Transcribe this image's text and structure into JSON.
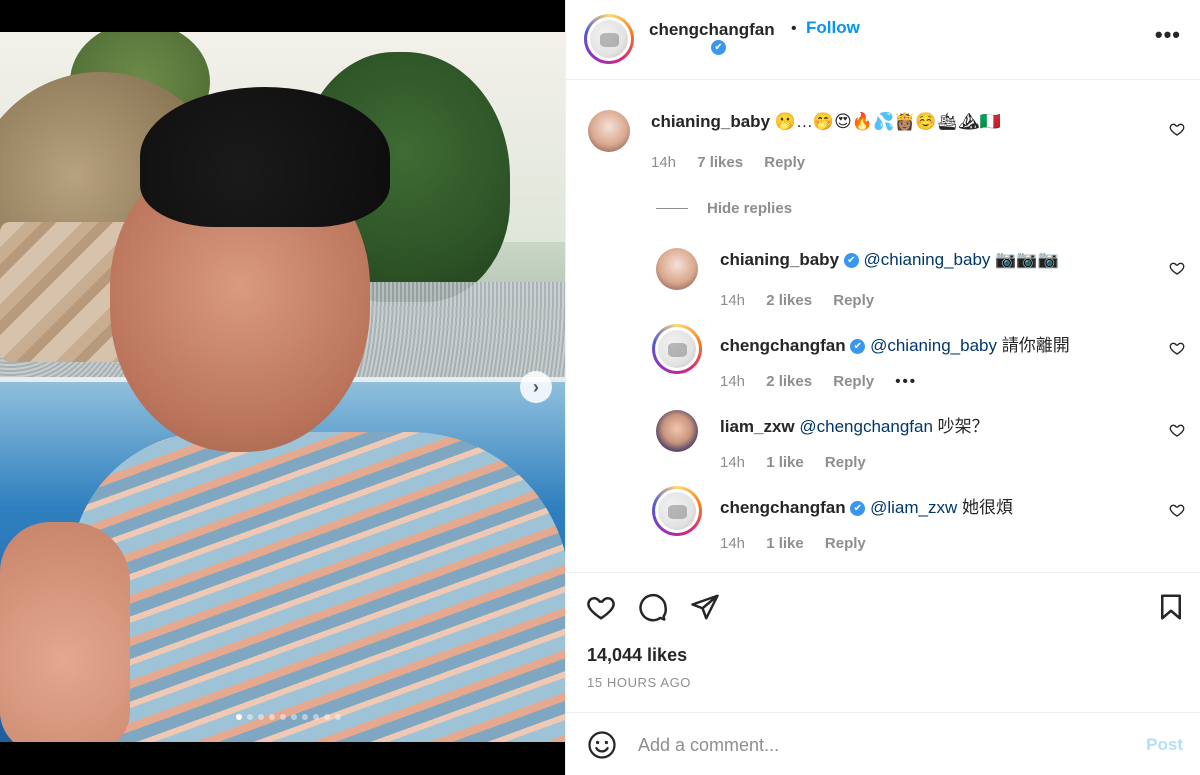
{
  "post": {
    "author": "chengchangfan",
    "follow_label": "Follow",
    "separator": "•",
    "verified_glyph": "✔",
    "more_glyph": "•••",
    "carousel": {
      "slide_count": 10,
      "active_index": 0,
      "next_glyph": "›"
    }
  },
  "comments": [
    {
      "user": "chianing_baby",
      "text": "🫢…🤭😍🔥💦👸🏽☺️🛳⛰🇮🇹",
      "time": "14h",
      "likes": "7 likes",
      "reply_label": "Reply"
    }
  ],
  "hide_replies_label": "Hide replies",
  "replies": [
    {
      "user": "chianing_baby",
      "mention": "@chianing_baby",
      "text": "📷📷📷",
      "time": "14h",
      "likes": "2 likes",
      "reply_label": "Reply"
    },
    {
      "user": "chengchangfan",
      "mention": "@chianing_baby",
      "text": "請你離開",
      "time": "14h",
      "likes": "2 likes",
      "reply_label": "Reply",
      "more": "•••"
    },
    {
      "user": "liam_zxw",
      "mention": "@chengchangfan",
      "text": "吵架？",
      "time": "14h",
      "likes": "1 like",
      "reply_label": "Reply"
    },
    {
      "user": "chengchangfan",
      "mention": "@liam_zxw",
      "text": "她很煩",
      "time": "14h",
      "likes": "1 like",
      "reply_label": "Reply"
    }
  ],
  "stats": {
    "likes": "14,044 likes",
    "time_ago": "15 HOURS AGO"
  },
  "composer": {
    "placeholder": "Add a comment...",
    "post_label": "Post"
  },
  "colors": {
    "accent": "#0095f6",
    "verified": "#3897f0",
    "mention": "#00376b",
    "muted": "#8e8e8e",
    "post_disabled": "#b2dffc"
  }
}
